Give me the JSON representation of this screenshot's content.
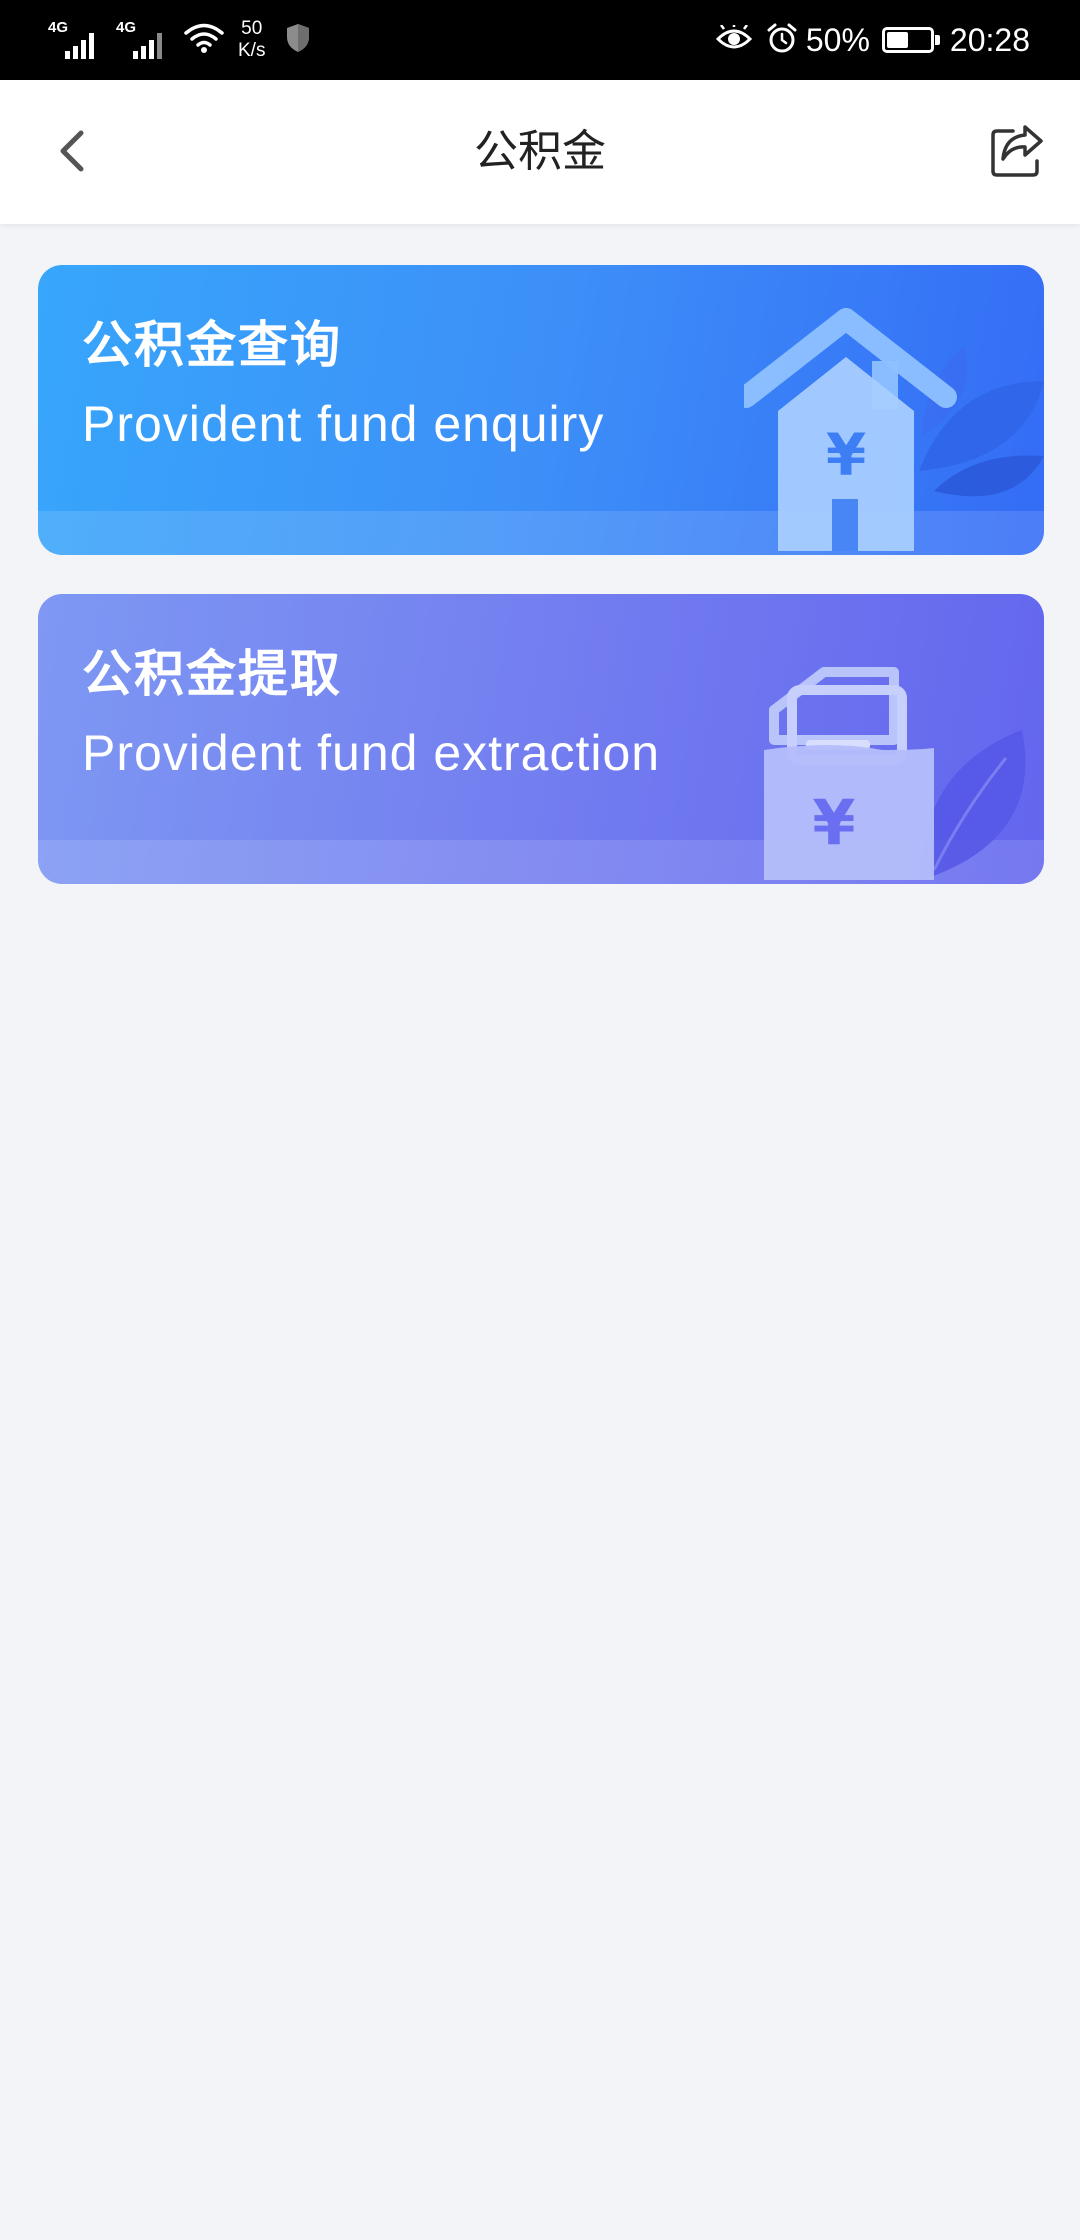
{
  "status_bar": {
    "network_1": "4G",
    "network_2": "4G",
    "speed_value": "50",
    "speed_unit": "K/s",
    "battery_percent": "50%",
    "battery_level": 0.5,
    "time": "20:28"
  },
  "nav": {
    "title": "公积金",
    "back_icon": "chevron-left-icon",
    "share_icon": "share-icon"
  },
  "cards": [
    {
      "title_cn": "公积金查询",
      "title_en": "Provident fund enquiry",
      "illustration": "house-yen-icon",
      "gradient": [
        "#37a6fb",
        "#346cf6"
      ]
    },
    {
      "title_cn": "公积金提取",
      "title_en": "Provident fund extraction",
      "illustration": "wallet-yen-icon",
      "gradient": [
        "#7e98f3",
        "#6366ee"
      ]
    }
  ],
  "colors": {
    "page_background": "#f3f4f8",
    "status_bar": "#000000",
    "nav_background": "#ffffff",
    "title_text": "#222222"
  }
}
